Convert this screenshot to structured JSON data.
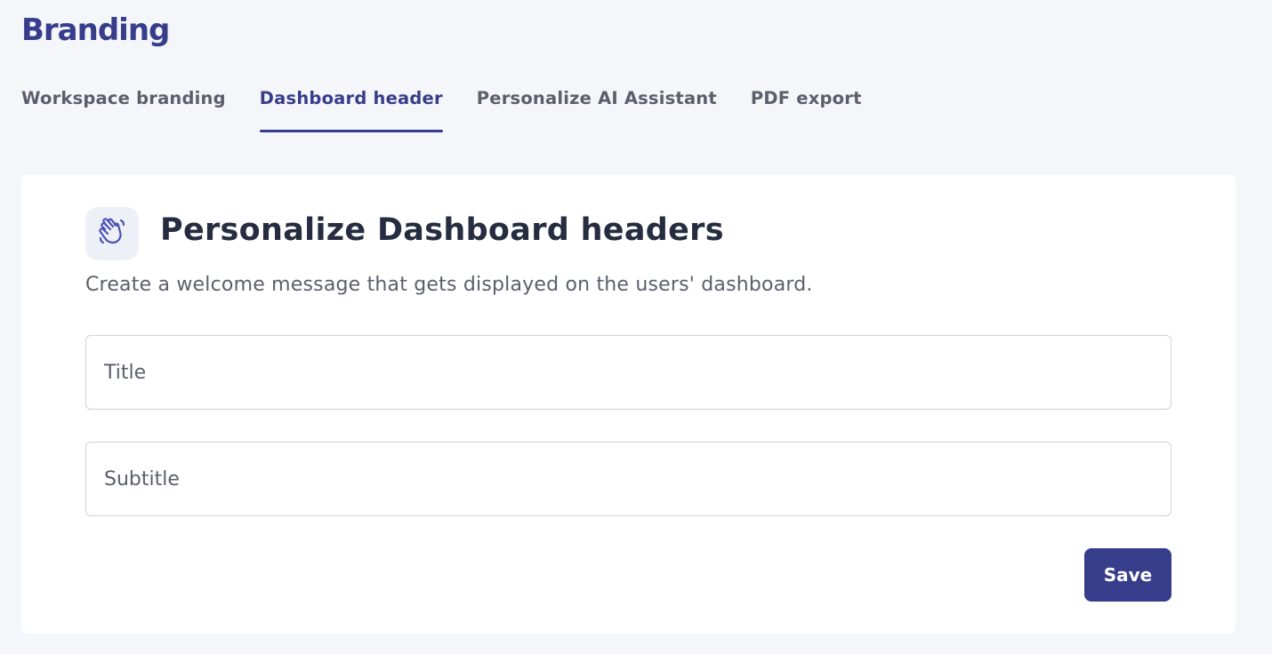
{
  "page": {
    "title": "Branding"
  },
  "tabs": [
    {
      "label": "Workspace branding",
      "active": false
    },
    {
      "label": "Dashboard header",
      "active": true
    },
    {
      "label": "Personalize AI Assistant",
      "active": false
    },
    {
      "label": "PDF export",
      "active": false
    }
  ],
  "card": {
    "icon": "waving-hand-icon",
    "title": "Personalize Dashboard headers",
    "description": "Create a welcome message that gets displayed on the users' dashboard.",
    "fields": {
      "title": {
        "placeholder": "Title",
        "value": ""
      },
      "subtitle": {
        "placeholder": "Subtitle",
        "value": ""
      }
    },
    "save_label": "Save"
  },
  "colors": {
    "accent": "#363d8a",
    "background": "#f5f6fa",
    "card": "#ffffff",
    "text": "#262d40",
    "muted_text": "#5b5f6b"
  }
}
